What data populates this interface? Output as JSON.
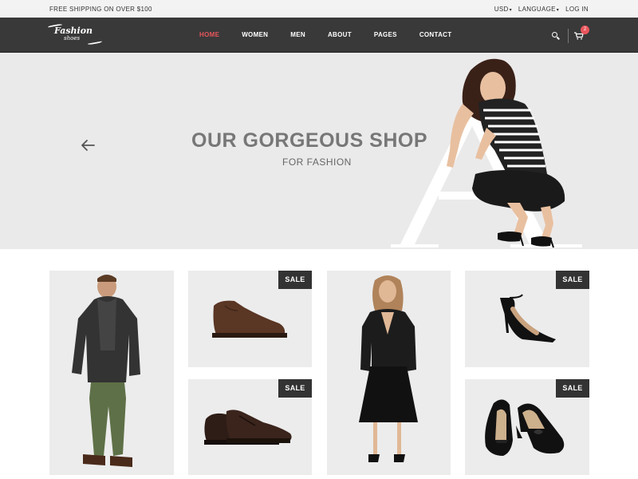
{
  "topbar": {
    "promo": "FREE SHIPPING ON OVER $100",
    "currency": "USD",
    "language": "LANGUAGE",
    "login": "LOG IN"
  },
  "logo": {
    "line1": "Fashion",
    "line2": "shoes"
  },
  "nav": {
    "items": [
      "HOME",
      "WOMEN",
      "MEN",
      "ABOUT",
      "PAGES",
      "CONTACT"
    ],
    "active": "HOME",
    "cart_count": "2"
  },
  "hero": {
    "title": "OUR GORGEOUS SHOP",
    "subtitle": "FOR FASHION",
    "decor_letter": "A"
  },
  "products": {
    "sale_label": "SALE",
    "cards": [
      {
        "image": "man-in-dark-coat-and-green-pants",
        "sale": false
      },
      {
        "image": "brown-leather-chukka-boot",
        "sale": true
      },
      {
        "image": "woman-in-black-dress",
        "sale": false
      },
      {
        "image": "black-pointed-heel-pump",
        "sale": true
      },
      {
        "image": "dark-brown-oxford-shoe",
        "sale": true
      },
      {
        "image": "black-bow-heel-pumps",
        "sale": true
      }
    ]
  },
  "colors": {
    "accent": "#e8565c",
    "navbar": "#393939",
    "hero_bg": "#ebeaea",
    "card_bg": "#ececec",
    "sale_bg": "#333333"
  },
  "icons": [
    "search-icon",
    "cart-icon",
    "arrow-left-icon",
    "caret-down-icon"
  ]
}
